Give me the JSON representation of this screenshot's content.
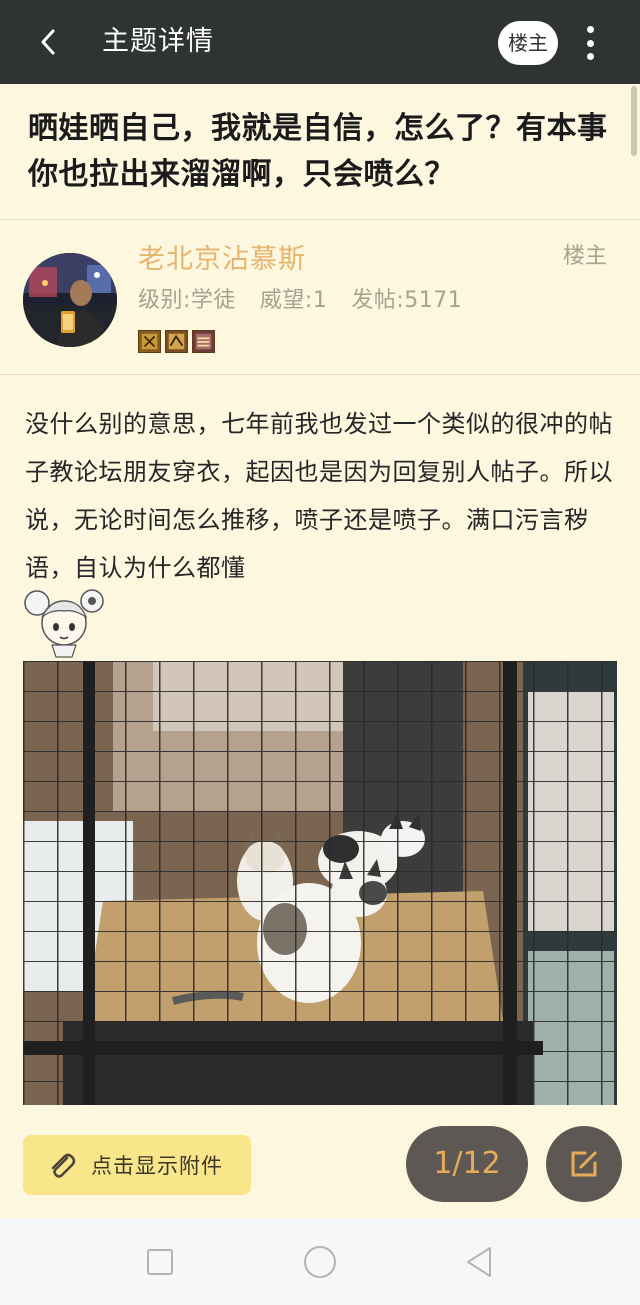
{
  "appbar": {
    "title": "主题详情",
    "op_button_label": "楼主",
    "back_icon": "chevron-left-icon",
    "more_icon": "more-vertical-icon"
  },
  "thread": {
    "title": "晒娃晒自己，我就是自信，怎么了？有本事你也拉出来溜溜啊，只会喷么？"
  },
  "author": {
    "name": "老北京沾慕斯",
    "tag": "楼主",
    "level": "级别:学徒",
    "prestige": "威望:1",
    "posts": "发帖:5171",
    "name_color": "#e7b470",
    "medals": [
      "medal-1",
      "medal-2",
      "medal-3"
    ]
  },
  "post": {
    "body": "没什么别的意思，七年前我也发过一个类似的很冲的帖子教论坛朋友穿衣，起因也是因为回复别人帖子。所以说，无论时间怎么推移，喷子还是喷子。满口污言秽语，自认为什么都懂"
  },
  "footer": {
    "attachment_label": "点击显示附件",
    "page_indicator": "1/12",
    "attachment_color": "#f9e58a",
    "pager_text_color": "#e8ab5a"
  },
  "system_nav": {
    "recent_icon": "square-icon",
    "home_icon": "circle-icon",
    "back_icon": "triangle-back-icon"
  }
}
